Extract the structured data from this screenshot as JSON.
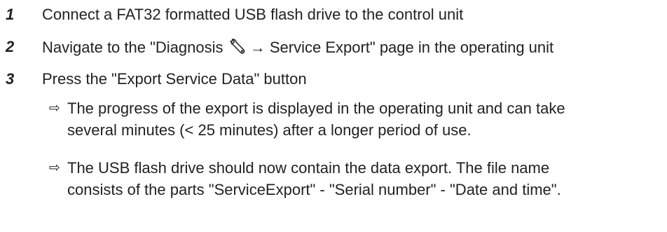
{
  "steps": [
    {
      "number": "1",
      "text": "Connect a FAT32 formatted USB flash drive to the control unit"
    },
    {
      "number": "2",
      "text_before": "Navigate to the \"Diagnosis ",
      "icon": "wrench-icon",
      "text_after": " → Service Export\" page in the operating unit"
    },
    {
      "number": "3",
      "text": "Press the \"Export Service Data\" button"
    }
  ],
  "results": [
    {
      "arrow": "⇨",
      "line1": "The progress of the export is displayed in the operating unit and can take",
      "line2": "several minutes (< 25 minutes) after a longer period of use."
    },
    {
      "arrow": "⇨",
      "line1": "The USB flash drive should now contain the data export. The file name",
      "line2": "consists of the parts \"ServiceExport\" - \"Serial number\" - \"Date and time\"."
    }
  ]
}
